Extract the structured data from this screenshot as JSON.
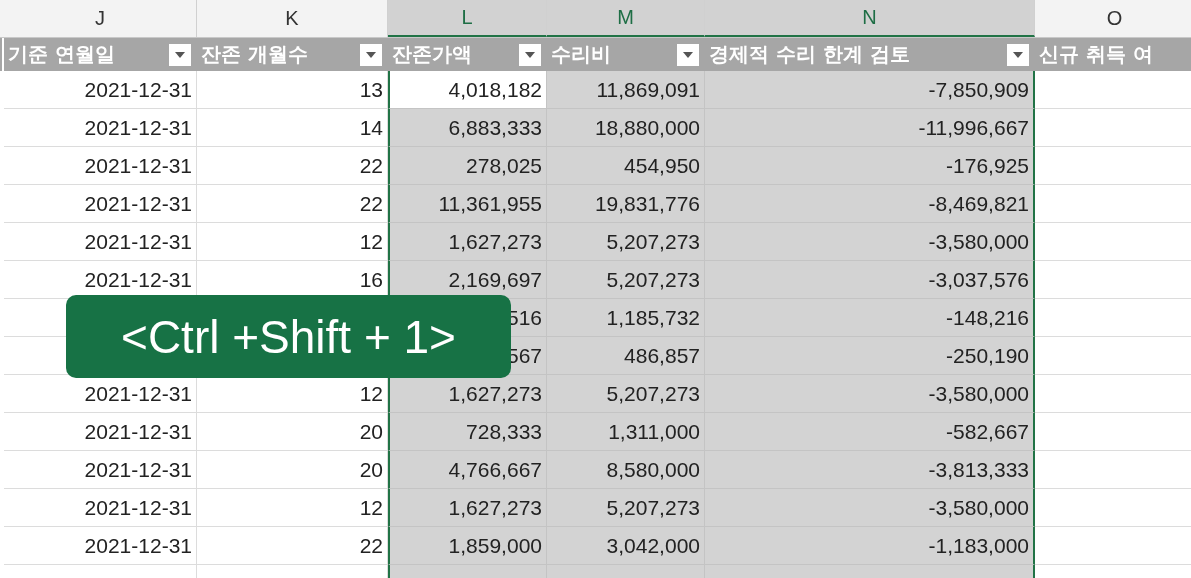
{
  "columns": [
    {
      "letter": "J",
      "header": "기준 연월일",
      "selected": false
    },
    {
      "letter": "K",
      "header": "잔존 개월수",
      "selected": false
    },
    {
      "letter": "L",
      "header": "잔존가액",
      "selected": true
    },
    {
      "letter": "M",
      "header": "수리비",
      "selected": true
    },
    {
      "letter": "N",
      "header": "경제적 수리 한계 검토",
      "selected": true
    },
    {
      "letter": "O",
      "header": "신규 취득 여",
      "selected": false
    }
  ],
  "rows": [
    {
      "cells": [
        "2021-12-31",
        "13",
        "4,018,182",
        "11,869,091",
        "-7,850,909"
      ],
      "active": true
    },
    {
      "cells": [
        "2021-12-31",
        "14",
        "6,883,333",
        "18,880,000",
        "-11,996,667"
      ],
      "active": false
    },
    {
      "cells": [
        "2021-12-31",
        "22",
        "278,025",
        "454,950",
        "-176,925"
      ],
      "active": false
    },
    {
      "cells": [
        "2021-12-31",
        "22",
        "11,361,955",
        "19,831,776",
        "-8,469,821"
      ],
      "active": false
    },
    {
      "cells": [
        "2021-12-31",
        "12",
        "1,627,273",
        "5,207,273",
        "-3,580,000"
      ],
      "active": false
    },
    {
      "cells": [
        "2021-12-31",
        "16",
        "2,169,697",
        "5,207,273",
        "-3,037,576"
      ],
      "active": false
    },
    {
      "cells": [
        "",
        "",
        "516",
        "1,185,732",
        "-148,216"
      ],
      "active": false
    },
    {
      "cells": [
        "",
        "",
        "567",
        "486,857",
        "-250,190"
      ],
      "active": false
    },
    {
      "cells": [
        "2021-12-31",
        "12",
        "1,627,273",
        "5,207,273",
        "-3,580,000"
      ],
      "active": false
    },
    {
      "cells": [
        "2021-12-31",
        "20",
        "728,333",
        "1,311,000",
        "-582,667"
      ],
      "active": false
    },
    {
      "cells": [
        "2021-12-31",
        "20",
        "4,766,667",
        "8,580,000",
        "-3,813,333"
      ],
      "active": false
    },
    {
      "cells": [
        "2021-12-31",
        "12",
        "1,627,273",
        "5,207,273",
        "-3,580,000"
      ],
      "active": false
    },
    {
      "cells": [
        "2021-12-31",
        "22",
        "1,859,000",
        "3,042,000",
        "-1,183,000"
      ],
      "active": false
    }
  ],
  "shortcut_overlay": {
    "text": "<Ctrl +Shift + 1>"
  }
}
